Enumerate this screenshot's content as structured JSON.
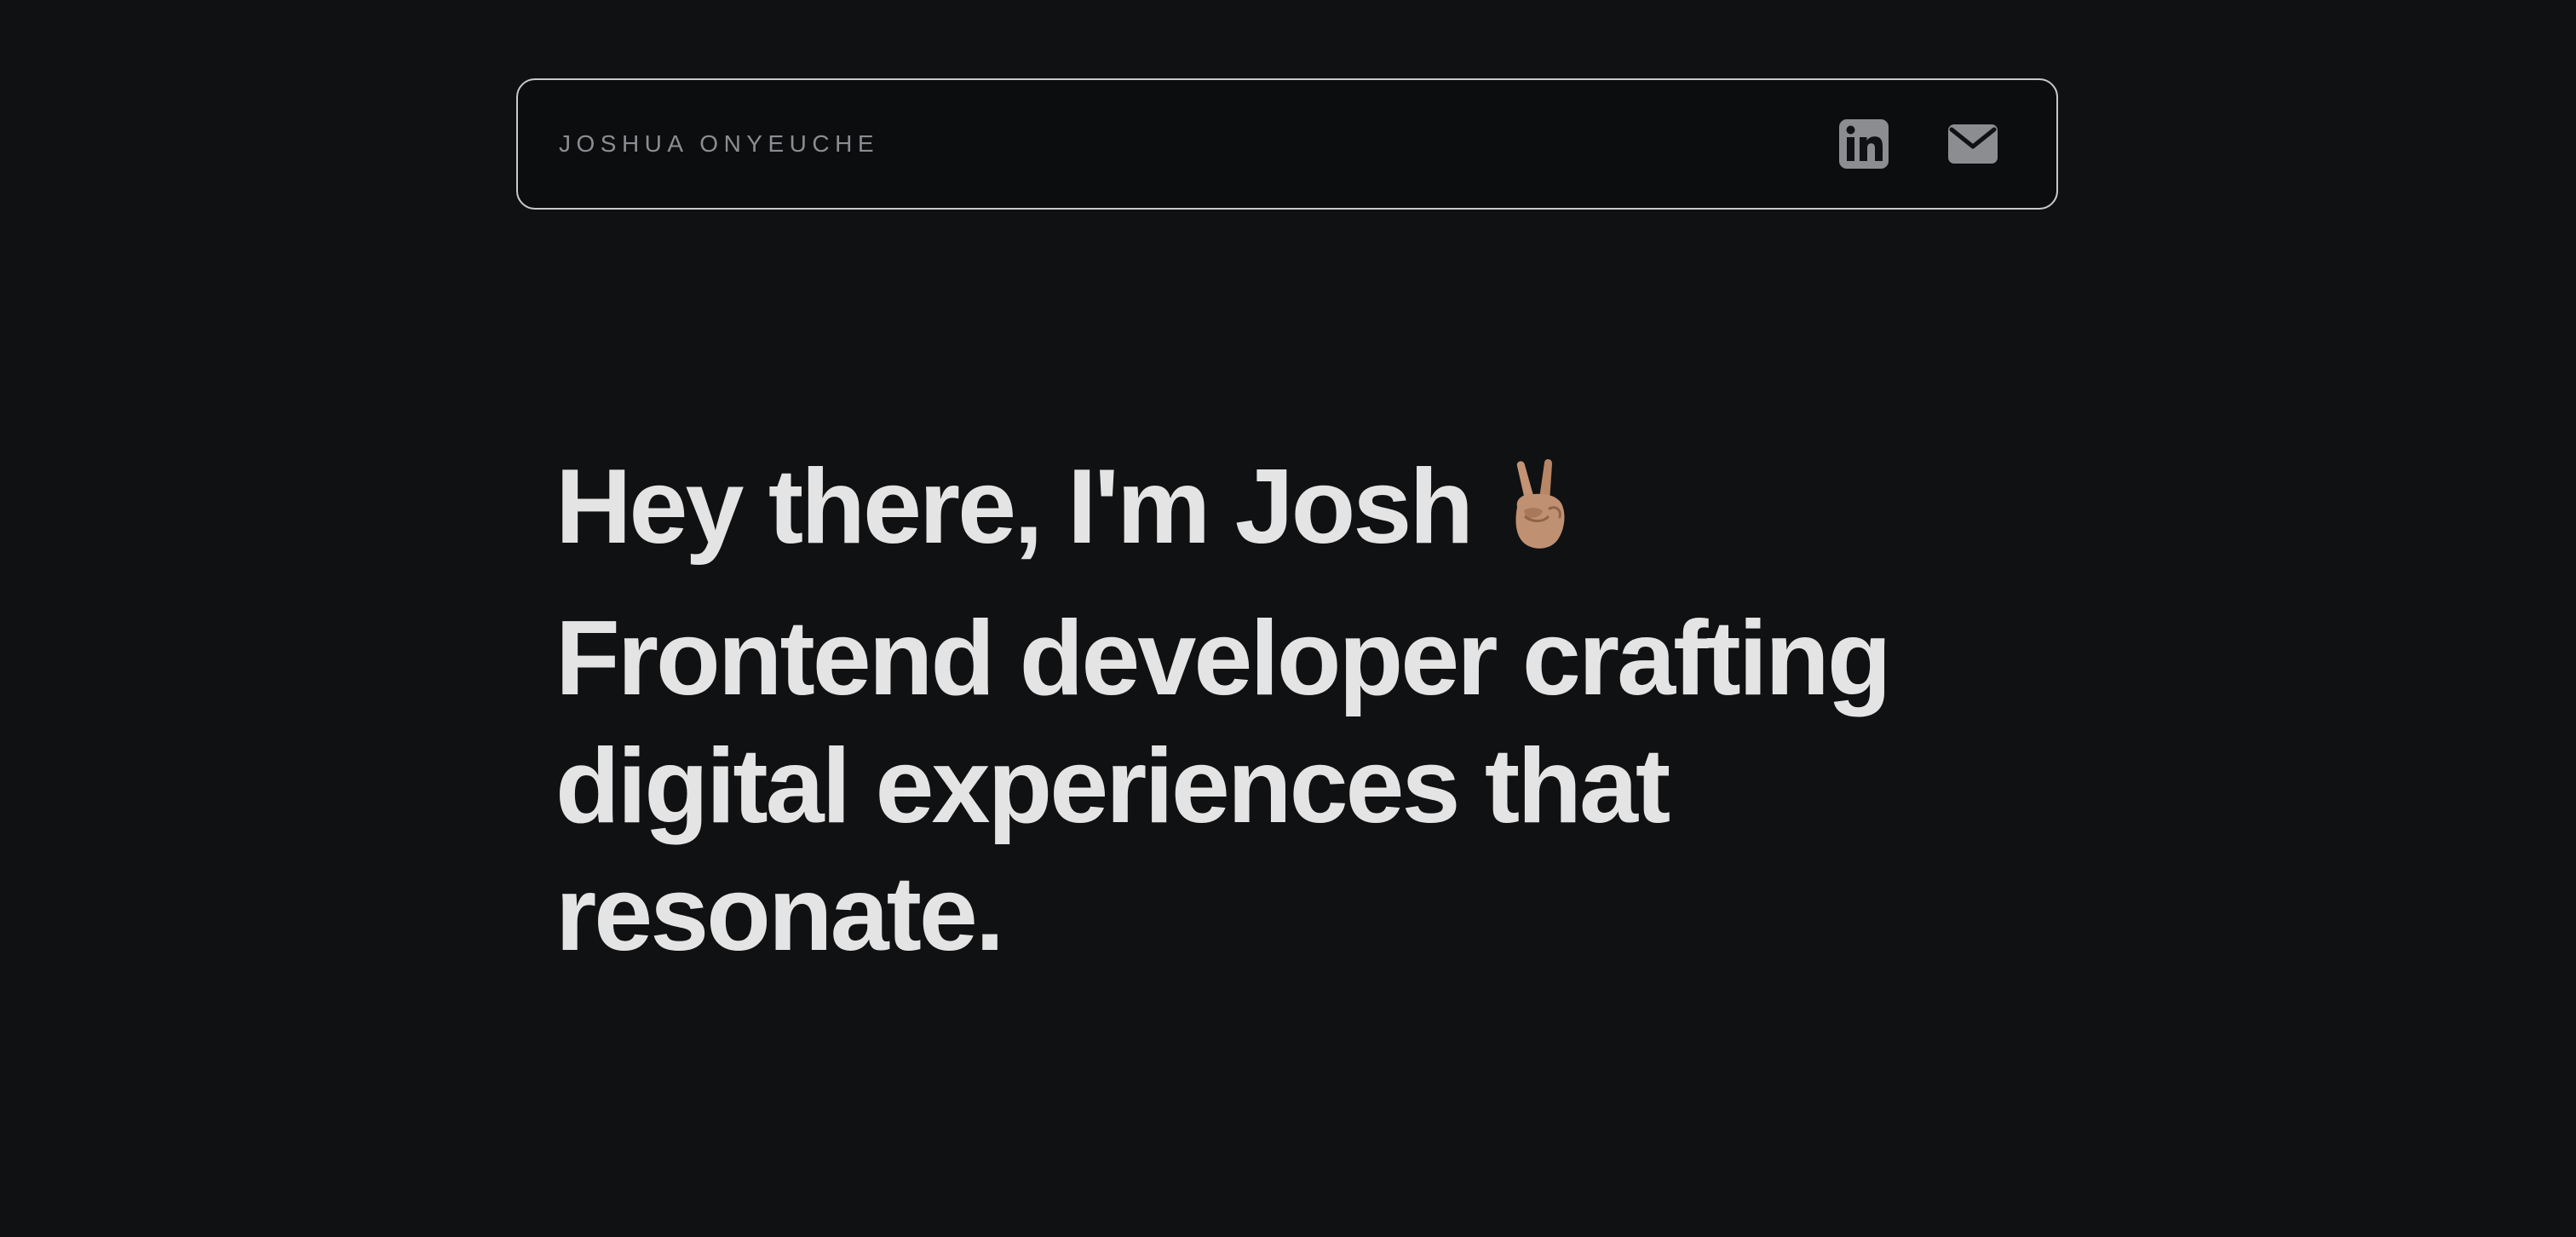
{
  "header": {
    "brand": "JOSHUA ONYEUCHE",
    "social": [
      {
        "icon": "linkedin-icon",
        "label": "LinkedIn"
      },
      {
        "icon": "mail-icon",
        "label": "Email"
      }
    ]
  },
  "hero": {
    "greeting": "Hey there, I'm Josh",
    "greeting_emoji": "victory-hand-emoji",
    "tagline": "Frontend developer crafting digital experiences that resonate."
  },
  "colors": {
    "background": "#101113",
    "navbar_background": "#0c0d0f",
    "navbar_border": "#c9c9cb",
    "brand_text": "#8c8d90",
    "icon": "#8c8d90",
    "heading_text": "#e4e4e4"
  }
}
